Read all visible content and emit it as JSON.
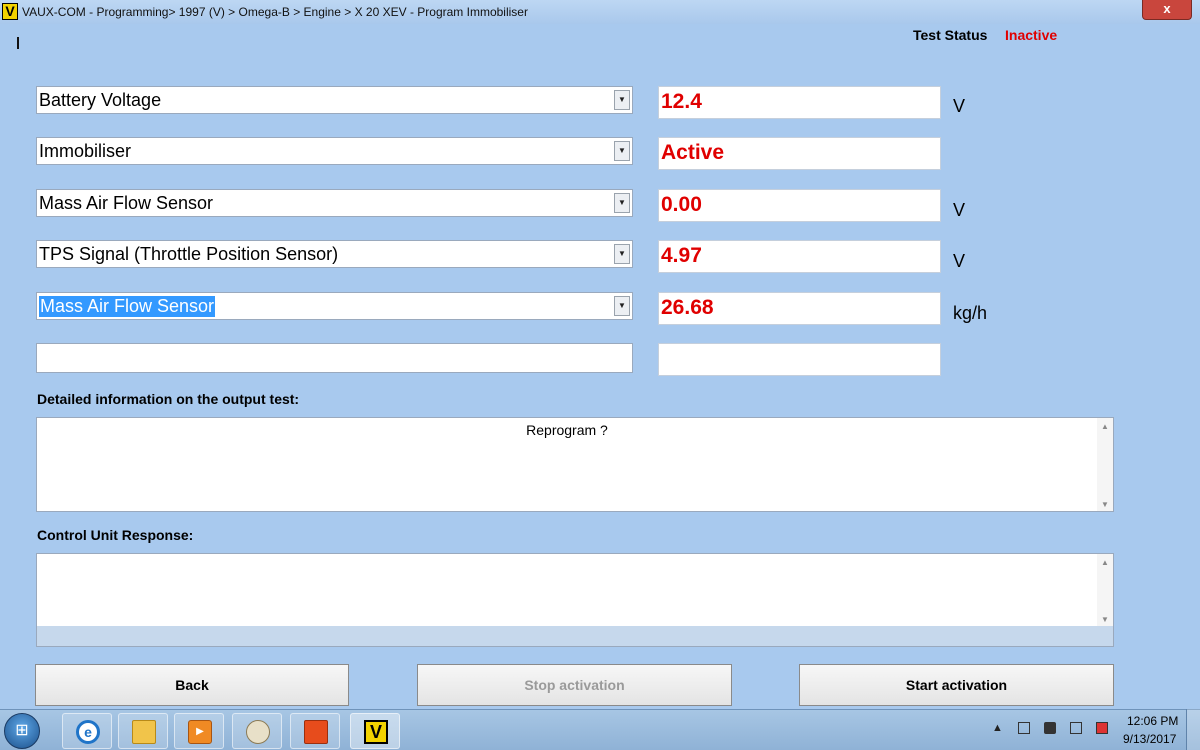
{
  "window": {
    "logo": "V",
    "title": "VAUX-COM - Programming> 1997 (V) > Omega-B > Engine > X 20 XEV - Program Immobiliser",
    "close_label": "x"
  },
  "status": {
    "label": "Test Status",
    "value": "Inactive",
    "value_color": "#e00000"
  },
  "rows": [
    {
      "selector": "Battery Voltage",
      "value": "12.4",
      "unit": "V"
    },
    {
      "selector": "Immobiliser",
      "value": "Active",
      "unit": ""
    },
    {
      "selector": "Mass Air Flow Sensor",
      "value": "0.00",
      "unit": "V"
    },
    {
      "selector": "TPS Signal (Throttle Position Sensor)",
      "value": "4.97",
      "unit": "V"
    },
    {
      "selector": "Mass Air Flow Sensor",
      "value": "26.68",
      "unit": "kg/h",
      "selected": true
    },
    {
      "selector": "",
      "value": "",
      "unit": ""
    }
  ],
  "details": {
    "label": "Detailed information on the output test:",
    "text": "Reprogram ?"
  },
  "response": {
    "label": "Control Unit Response:",
    "text": ""
  },
  "buttons": {
    "back": "Back",
    "stop": "Stop activation",
    "start": "Start activation"
  },
  "taskbar": {
    "start_glyph": "⊞",
    "icons": [
      "internet-explorer-icon",
      "folder-icon",
      "media-player-icon",
      "paint-icon",
      "office-icon",
      "vaux-com-icon"
    ],
    "ie_glyph": "e",
    "media_glyph": "▶",
    "vaux_glyph": "V"
  },
  "tray": {
    "arrow": "▲",
    "time": "12:06 PM",
    "date": "9/13/2017"
  },
  "colors": {
    "background": "#a8c9ee",
    "value_text": "#e00000",
    "selection": "#3399ff"
  }
}
